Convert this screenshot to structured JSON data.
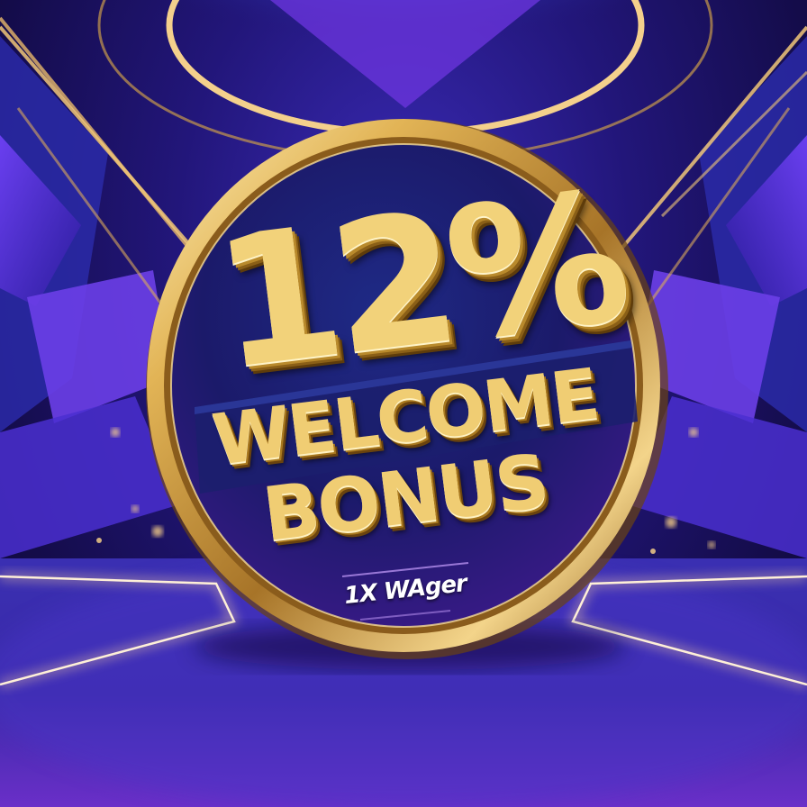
{
  "badge": {
    "headline": "12%",
    "line1": "WELCOME",
    "line2": "BONUS",
    "subtext": "1X WAger"
  },
  "colors": {
    "gold": "#f2d27a",
    "gold_dark": "#8a5f17",
    "navy": "#1a1460",
    "purple": "#5b2fc9",
    "accent_blue": "#3ea8ff"
  }
}
